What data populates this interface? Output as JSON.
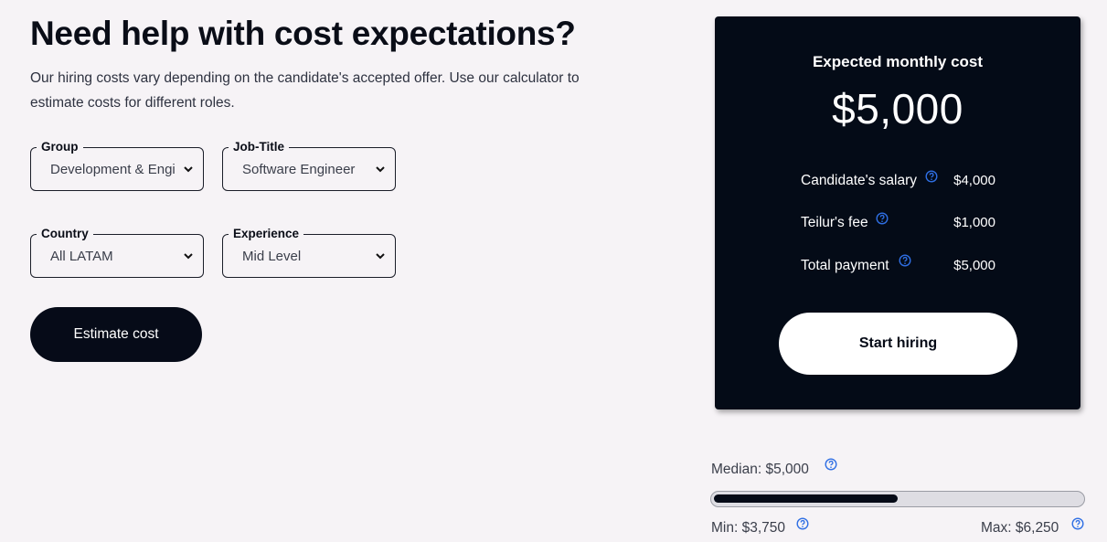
{
  "hero": {
    "title": "Need help with cost expectations?",
    "description": "Our hiring costs vary depending on the candidate's accepted offer. Use our calculator to estimate costs for different roles."
  },
  "form": {
    "group": {
      "label": "Group",
      "value": "Development & Engineering"
    },
    "job_title": {
      "label": "Job-Title",
      "value": "Software Engineer"
    },
    "country": {
      "label": "Country",
      "value": "All LATAM"
    },
    "experience": {
      "label": "Experience",
      "value": "Mid Level"
    },
    "estimate_button": "Estimate cost"
  },
  "result_card": {
    "title": "Expected monthly cost",
    "amount": "$5,000",
    "rows": [
      {
        "label": "Candidate's salary",
        "value": "$4,000"
      },
      {
        "label": "Teilur's fee",
        "value": "$1,000"
      },
      {
        "label": "Total payment",
        "value": "$5,000"
      }
    ],
    "start_button": "Start hiring"
  },
  "range": {
    "median_label": "Median: $5,000",
    "min_label": "Min: $3,750",
    "max_label": "Max: $6,250",
    "median_fraction": 0.5
  },
  "colors": {
    "background": "#f6f3f6",
    "card_background": "#040b17",
    "help_icon_blue": "#2f6fe4",
    "primary_dark": "#060b18"
  },
  "icons": {
    "help": "help-circle-icon",
    "dropdown": "chevron-down-icon"
  }
}
